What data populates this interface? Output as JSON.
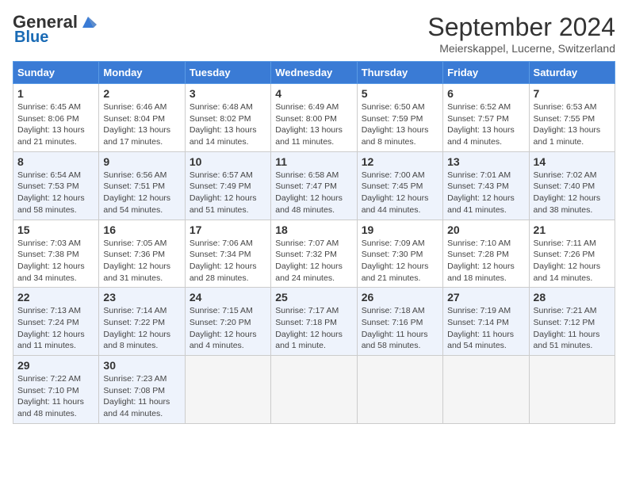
{
  "header": {
    "logo_general": "General",
    "logo_blue": "Blue",
    "title": "September 2024",
    "location": "Meierskappel, Lucerne, Switzerland"
  },
  "columns": [
    "Sunday",
    "Monday",
    "Tuesday",
    "Wednesday",
    "Thursday",
    "Friday",
    "Saturday"
  ],
  "weeks": [
    [
      {
        "day": "1",
        "info": "Sunrise: 6:45 AM\nSunset: 8:06 PM\nDaylight: 13 hours\nand 21 minutes."
      },
      {
        "day": "2",
        "info": "Sunrise: 6:46 AM\nSunset: 8:04 PM\nDaylight: 13 hours\nand 17 minutes."
      },
      {
        "day": "3",
        "info": "Sunrise: 6:48 AM\nSunset: 8:02 PM\nDaylight: 13 hours\nand 14 minutes."
      },
      {
        "day": "4",
        "info": "Sunrise: 6:49 AM\nSunset: 8:00 PM\nDaylight: 13 hours\nand 11 minutes."
      },
      {
        "day": "5",
        "info": "Sunrise: 6:50 AM\nSunset: 7:59 PM\nDaylight: 13 hours\nand 8 minutes."
      },
      {
        "day": "6",
        "info": "Sunrise: 6:52 AM\nSunset: 7:57 PM\nDaylight: 13 hours\nand 4 minutes."
      },
      {
        "day": "7",
        "info": "Sunrise: 6:53 AM\nSunset: 7:55 PM\nDaylight: 13 hours\nand 1 minute."
      }
    ],
    [
      {
        "day": "8",
        "info": "Sunrise: 6:54 AM\nSunset: 7:53 PM\nDaylight: 12 hours\nand 58 minutes."
      },
      {
        "day": "9",
        "info": "Sunrise: 6:56 AM\nSunset: 7:51 PM\nDaylight: 12 hours\nand 54 minutes."
      },
      {
        "day": "10",
        "info": "Sunrise: 6:57 AM\nSunset: 7:49 PM\nDaylight: 12 hours\nand 51 minutes."
      },
      {
        "day": "11",
        "info": "Sunrise: 6:58 AM\nSunset: 7:47 PM\nDaylight: 12 hours\nand 48 minutes."
      },
      {
        "day": "12",
        "info": "Sunrise: 7:00 AM\nSunset: 7:45 PM\nDaylight: 12 hours\nand 44 minutes."
      },
      {
        "day": "13",
        "info": "Sunrise: 7:01 AM\nSunset: 7:43 PM\nDaylight: 12 hours\nand 41 minutes."
      },
      {
        "day": "14",
        "info": "Sunrise: 7:02 AM\nSunset: 7:40 PM\nDaylight: 12 hours\nand 38 minutes."
      }
    ],
    [
      {
        "day": "15",
        "info": "Sunrise: 7:03 AM\nSunset: 7:38 PM\nDaylight: 12 hours\nand 34 minutes."
      },
      {
        "day": "16",
        "info": "Sunrise: 7:05 AM\nSunset: 7:36 PM\nDaylight: 12 hours\nand 31 minutes."
      },
      {
        "day": "17",
        "info": "Sunrise: 7:06 AM\nSunset: 7:34 PM\nDaylight: 12 hours\nand 28 minutes."
      },
      {
        "day": "18",
        "info": "Sunrise: 7:07 AM\nSunset: 7:32 PM\nDaylight: 12 hours\nand 24 minutes."
      },
      {
        "day": "19",
        "info": "Sunrise: 7:09 AM\nSunset: 7:30 PM\nDaylight: 12 hours\nand 21 minutes."
      },
      {
        "day": "20",
        "info": "Sunrise: 7:10 AM\nSunset: 7:28 PM\nDaylight: 12 hours\nand 18 minutes."
      },
      {
        "day": "21",
        "info": "Sunrise: 7:11 AM\nSunset: 7:26 PM\nDaylight: 12 hours\nand 14 minutes."
      }
    ],
    [
      {
        "day": "22",
        "info": "Sunrise: 7:13 AM\nSunset: 7:24 PM\nDaylight: 12 hours\nand 11 minutes."
      },
      {
        "day": "23",
        "info": "Sunrise: 7:14 AM\nSunset: 7:22 PM\nDaylight: 12 hours\nand 8 minutes."
      },
      {
        "day": "24",
        "info": "Sunrise: 7:15 AM\nSunset: 7:20 PM\nDaylight: 12 hours\nand 4 minutes."
      },
      {
        "day": "25",
        "info": "Sunrise: 7:17 AM\nSunset: 7:18 PM\nDaylight: 12 hours\nand 1 minute."
      },
      {
        "day": "26",
        "info": "Sunrise: 7:18 AM\nSunset: 7:16 PM\nDaylight: 11 hours\nand 58 minutes."
      },
      {
        "day": "27",
        "info": "Sunrise: 7:19 AM\nSunset: 7:14 PM\nDaylight: 11 hours\nand 54 minutes."
      },
      {
        "day": "28",
        "info": "Sunrise: 7:21 AM\nSunset: 7:12 PM\nDaylight: 11 hours\nand 51 minutes."
      }
    ],
    [
      {
        "day": "29",
        "info": "Sunrise: 7:22 AM\nSunset: 7:10 PM\nDaylight: 11 hours\nand 48 minutes."
      },
      {
        "day": "30",
        "info": "Sunrise: 7:23 AM\nSunset: 7:08 PM\nDaylight: 11 hours\nand 44 minutes."
      },
      {
        "day": "",
        "info": ""
      },
      {
        "day": "",
        "info": ""
      },
      {
        "day": "",
        "info": ""
      },
      {
        "day": "",
        "info": ""
      },
      {
        "day": "",
        "info": ""
      }
    ]
  ]
}
